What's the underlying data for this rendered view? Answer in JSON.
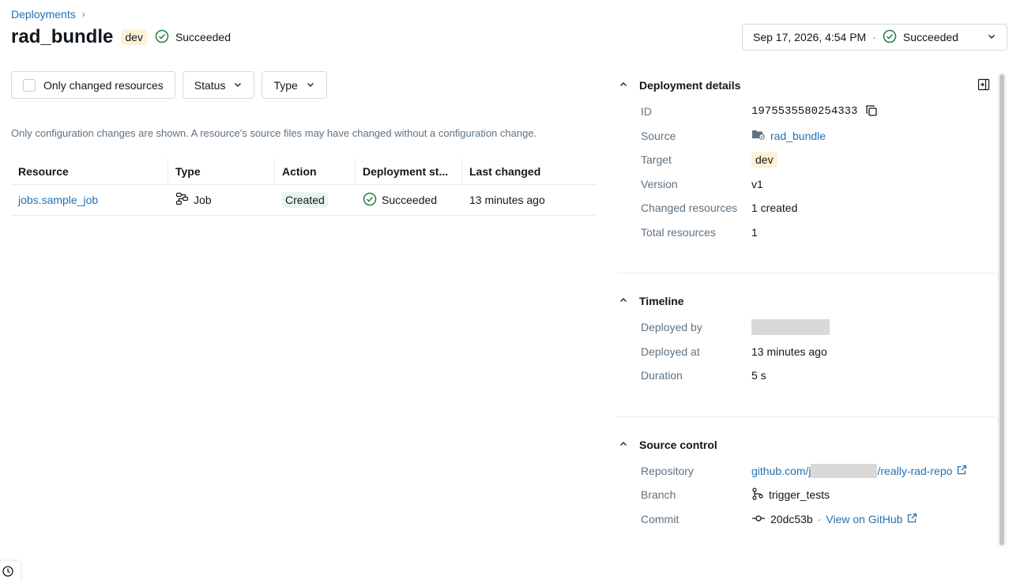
{
  "breadcrumb": {
    "parent": "Deployments",
    "separator": "›"
  },
  "header": {
    "title": "rad_bundle",
    "target_tag": "dev",
    "status": "Succeeded"
  },
  "version_select": {
    "timestamp": "Sep 17, 2026, 4:54 PM",
    "separator": "·",
    "status": "Succeeded"
  },
  "filters": {
    "only_changed": "Only changed resources",
    "status": "Status",
    "type": "Type"
  },
  "info_text": "Only configuration changes are shown. A resource's source files may have changed without a configuration change.",
  "table": {
    "columns": [
      "Resource",
      "Type",
      "Action",
      "Deployment st...",
      "Last changed"
    ],
    "rows": [
      {
        "resource": "jobs.sample_job",
        "type": "Job",
        "action": "Created",
        "status": "Succeeded",
        "last_changed": "13 minutes ago"
      }
    ]
  },
  "details": {
    "title": "Deployment details",
    "rows": [
      {
        "key": "ID",
        "value": "1975535580254333"
      },
      {
        "key": "Source",
        "value": "rad_bundle"
      },
      {
        "key": "Target",
        "value": "dev"
      },
      {
        "key": "Version",
        "value": "v1"
      },
      {
        "key": "Changed resources",
        "value": "1 created"
      },
      {
        "key": "Total resources",
        "value": "1"
      }
    ]
  },
  "timeline": {
    "title": "Timeline",
    "rows": [
      {
        "key": "Deployed by",
        "value": ""
      },
      {
        "key": "Deployed at",
        "value": "13 minutes ago"
      },
      {
        "key": "Duration",
        "value": "5 s"
      }
    ]
  },
  "source_control": {
    "title": "Source control",
    "repository_label": "Repository",
    "repository_prefix": "github.com/j",
    "repository_suffix": "/really-rad-repo",
    "branch_label": "Branch",
    "branch": "trigger_tests",
    "commit_label": "Commit",
    "commit": "20dc53b",
    "commit_sep": "·",
    "view_link": "View on GitHub"
  },
  "colors": {
    "link": "#2272b4",
    "success": "#277c43",
    "tag_bg": "#fff1d6"
  }
}
